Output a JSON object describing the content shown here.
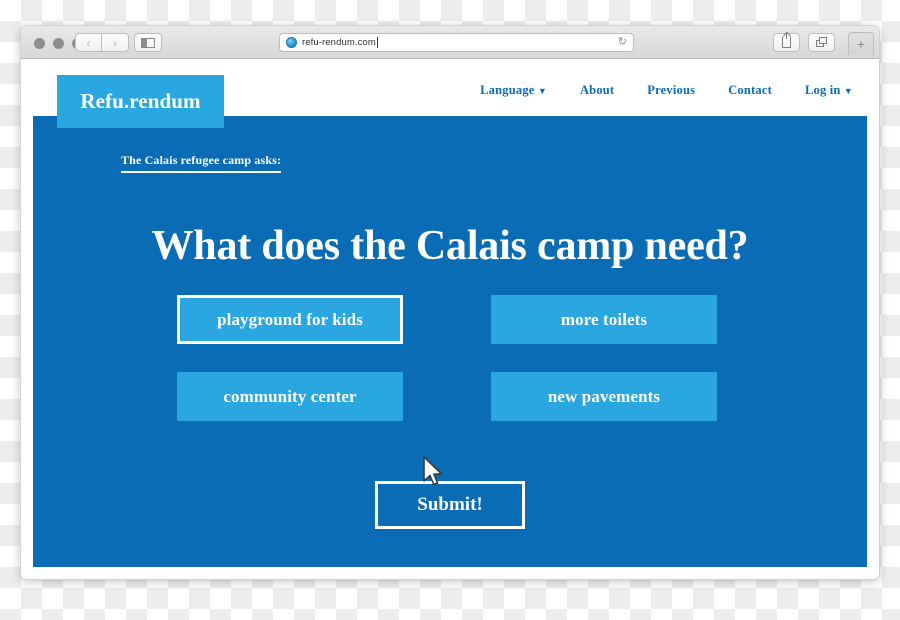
{
  "browser": {
    "url": "refu-rendum.com",
    "favicon": "globe-icon",
    "reload_icon": "↻",
    "back_icon": "‹",
    "forward_icon": "›",
    "sidebar_icon": "sidebar-icon",
    "share_icon": "share-icon",
    "tabs_icon": "tabs-icon",
    "new_tab_label": "+",
    "traffic_lights": [
      "close",
      "minimize",
      "zoom"
    ]
  },
  "site": {
    "logo": "Refu.rendum",
    "nav": [
      {
        "label": "Language",
        "has_caret": true,
        "caret": "▼"
      },
      {
        "label": "About",
        "has_caret": false,
        "caret": ""
      },
      {
        "label": "Previous",
        "has_caret": false,
        "caret": ""
      },
      {
        "label": "Contact",
        "has_caret": false,
        "caret": ""
      },
      {
        "label": "Log in",
        "has_caret": true,
        "caret": "▼"
      }
    ],
    "tagline": "The Calais refugee camp asks:",
    "headline": "What does the Calais camp need?",
    "options": [
      {
        "label": "playground for kids",
        "selected": true
      },
      {
        "label": "more toilets",
        "selected": false
      },
      {
        "label": "community center",
        "selected": false
      },
      {
        "label": "new pavements",
        "selected": false
      }
    ],
    "submit_label": "Submit!",
    "colors": {
      "body_blue": "#0a6cb4",
      "accent_blue": "#2aa7e0",
      "text_white": "#ffffff"
    }
  }
}
